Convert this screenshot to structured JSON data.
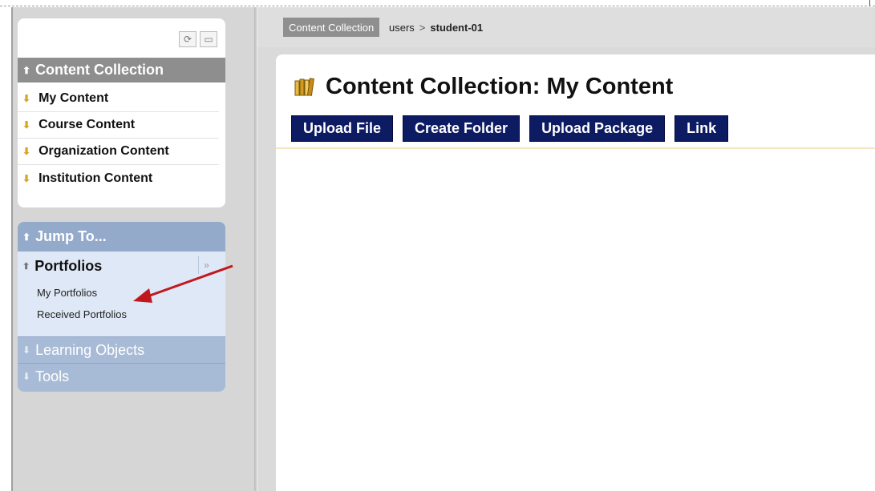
{
  "sidebar": {
    "tool_refresh_icon": "⟳",
    "tool_folder_icon": "▭",
    "content_collection": {
      "header": "Content Collection",
      "items": [
        {
          "label": "My Content"
        },
        {
          "label": "Course Content"
        },
        {
          "label": "Organization Content"
        },
        {
          "label": "Institution Content"
        }
      ]
    },
    "jump_to": {
      "header": "Jump To...",
      "portfolios": {
        "title": "Portfolios",
        "items": [
          {
            "label": "My Portfolios"
          },
          {
            "label": "Received Portfolios"
          }
        ]
      },
      "learning_objects": "Learning Objects",
      "tools": "Tools"
    }
  },
  "breadcrumb": {
    "root": "Content Collection",
    "path": "users",
    "separator": ">",
    "current": "student-01"
  },
  "main": {
    "title": "Content Collection: My Content",
    "actions": [
      "Upload File",
      "Create Folder",
      "Upload Package",
      "Link"
    ]
  },
  "colors": {
    "action_button": "#0d1b63",
    "jump_header": "#94aacb",
    "annotation_arrow": "#c0181d"
  }
}
